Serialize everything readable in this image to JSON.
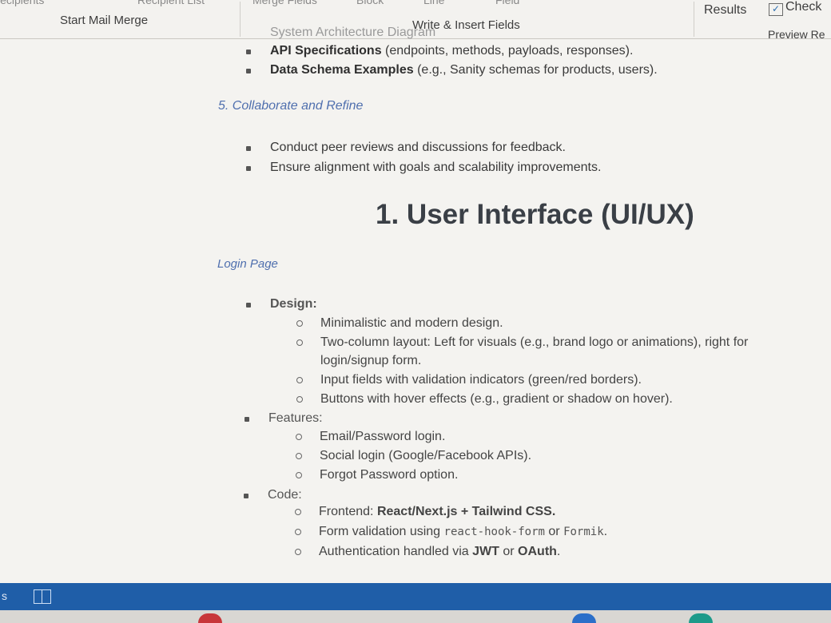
{
  "ribbon": {
    "top_fragments": [
      "Recipients",
      "Recipient List",
      "Merge Fields",
      "Block",
      "Line",
      "Field"
    ],
    "start_mail_merge": "Start Mail Merge",
    "write_insert_fields": "Write & Insert Fields",
    "results": "Results",
    "check": "Check",
    "preview": "Preview Re"
  },
  "document": {
    "top_partial": "System Architecture Diagram",
    "bullets_top": [
      {
        "bold": "API Specifications",
        "rest": " (endpoints, methods, payloads, responses)."
      },
      {
        "bold": "Data Schema Examples",
        "rest": " (e.g., Sanity schemas for products, users)."
      }
    ],
    "section5": "5. Collaborate and Refine",
    "collab_bullets": [
      "Conduct peer reviews and discussions for feedback.",
      "Ensure alignment with goals and scalability improvements."
    ],
    "heading": "1. User Interface (UI/UX)",
    "login_page": "Login Page",
    "design_label": "Design:",
    "design_items": [
      "Minimalistic and modern design.",
      "Two-column layout: Left for visuals (e.g., brand logo or animations), right for",
      "login/signup form.",
      "Input fields with validation indicators (green/red borders).",
      "Buttons with hover effects (e.g., gradient or shadow on hover)."
    ],
    "features_label": "Features:",
    "features_items": [
      "Email/Password login.",
      "Social login (Google/Facebook APIs).",
      "Forgot Password option."
    ],
    "code_label": "Code:",
    "code_items": {
      "frontend_prefix": "Frontend: ",
      "frontend_bold": "React/Next.js + Tailwind CSS.",
      "validation_prefix": "Form validation using ",
      "validation_lib1": "react-hook-form",
      "validation_or": " or ",
      "validation_lib2": "Formik",
      "validation_end": ".",
      "auth_prefix": "Authentication handled via ",
      "auth_bold1": "JWT",
      "auth_or": " or ",
      "auth_bold2": "OAuth",
      "auth_end": "."
    }
  },
  "statusbar": {
    "left_text": "s"
  }
}
